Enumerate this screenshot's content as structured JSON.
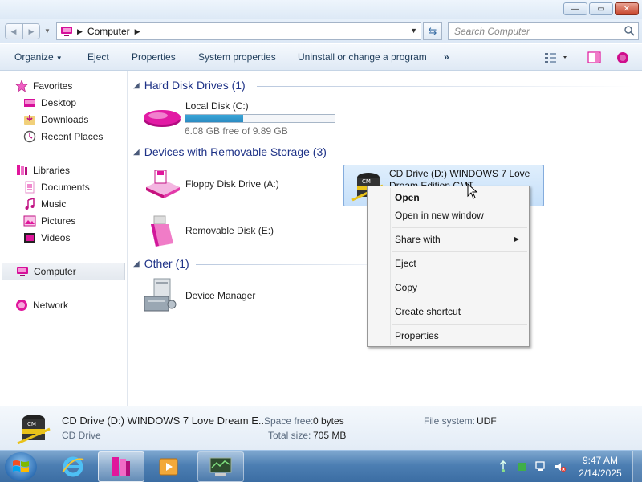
{
  "window": {
    "controls": {
      "minimize": "—",
      "maximize": "▭",
      "close": "✕"
    }
  },
  "address": {
    "location": "Computer",
    "search_placeholder": "Search Computer"
  },
  "toolbar": {
    "organize": "Organize",
    "eject": "Eject",
    "properties": "Properties",
    "system_properties": "System properties",
    "uninstall": "Uninstall or change a program",
    "more": "»"
  },
  "nav": {
    "favorites": "Favorites",
    "desktop": "Desktop",
    "downloads": "Downloads",
    "recent_places": "Recent Places",
    "libraries": "Libraries",
    "documents": "Documents",
    "music": "Music",
    "pictures": "Pictures",
    "videos": "Videos",
    "computer": "Computer",
    "network": "Network"
  },
  "content": {
    "hdd_group": "Hard Disk Drives (1)",
    "local_disk": {
      "name": "Local Disk (C:)",
      "free": "6.08 GB free of 9.89 GB",
      "used_fraction": 0.385
    },
    "removable_group": "Devices with Removable Storage (3)",
    "floppy": "Floppy Disk Drive (A:)",
    "cd_drive": "CD Drive (D:) WINDOWS 7 Love Dream Edition CMT",
    "removable_disk": "Removable Disk (E:)",
    "other_group": "Other (1)",
    "device_manager": "Device Manager"
  },
  "context_menu": {
    "open": "Open",
    "open_new_window": "Open in new window",
    "share_with": "Share with",
    "eject": "Eject",
    "copy": "Copy",
    "create_shortcut": "Create shortcut",
    "properties": "Properties"
  },
  "details": {
    "name": "CD Drive (D:) WINDOWS 7 Love Dream E...",
    "type": "CD Drive",
    "space_free_label": "Space free:",
    "space_free_value": "0 bytes",
    "total_size_label": "Total size:",
    "total_size_value": "705 MB",
    "file_system_label": "File system:",
    "file_system_value": "UDF"
  },
  "taskbar": {
    "time": "9:47 AM",
    "date": "2/14/2025"
  },
  "colors": {
    "accent_pink": "#e0169c",
    "group_header": "#1e3287",
    "capacity_fill": "#2b8bc2"
  }
}
